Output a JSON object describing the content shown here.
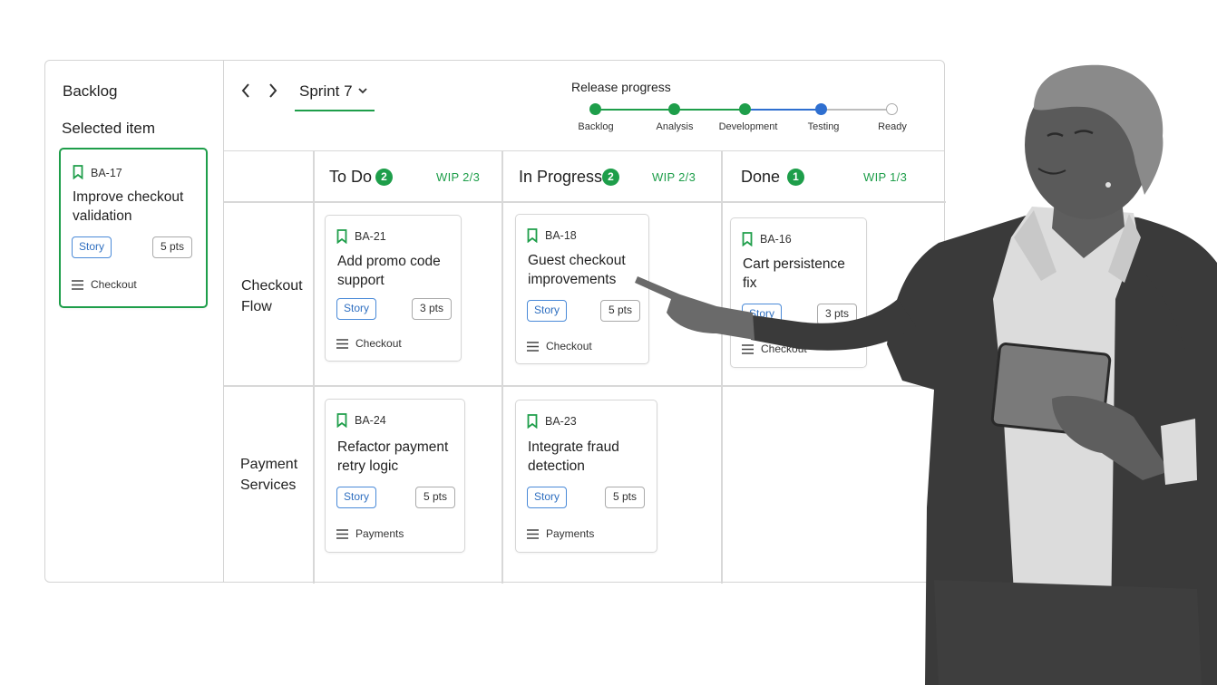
{
  "backlog": {
    "title": "Backlog",
    "selected_label": "Selected item",
    "selected_card": {
      "id": "BA-17",
      "title": "Improve checkout validation",
      "tag": "Story",
      "points": "5 pts",
      "component": "Checkout"
    }
  },
  "header": {
    "sprint": "Sprint 7",
    "release_title": "Release progress",
    "steps": [
      {
        "label": "Backlog",
        "state": "done"
      },
      {
        "label": "Analysis",
        "state": "done"
      },
      {
        "label": "Development",
        "state": "done"
      },
      {
        "label": "Testing",
        "state": "current"
      },
      {
        "label": "Ready",
        "state": "pending"
      }
    ]
  },
  "columns": [
    {
      "title": "To Do",
      "count": "2",
      "wip": "WIP  2/3"
    },
    {
      "title": "In Progress",
      "count": "2",
      "wip": "WIP  2/3"
    },
    {
      "title": "Done",
      "count": "1",
      "wip": "WIP  1/3"
    }
  ],
  "rows": [
    {
      "label": "Checkout Flow"
    },
    {
      "label": "Payment Services"
    }
  ],
  "cards": [
    {
      "id": "BA-21",
      "title": "Add promo code support",
      "tag": "Story",
      "points": "3 pts",
      "component": "Checkout"
    },
    {
      "id": "BA-18",
      "title": "Guest checkout improvements",
      "tag": "Story",
      "points": "5 pts",
      "component": "Checkout"
    },
    {
      "id": "BA-16",
      "title": "Cart persistence fix",
      "tag": "Story",
      "points": "3 pts",
      "component": "Checkout"
    },
    {
      "id": "BA-24",
      "title": "Refactor payment retry logic",
      "tag": "Story",
      "points": "5 pts",
      "component": "Payments"
    },
    {
      "id": "BA-23",
      "title": "Integrate fraud detection",
      "tag": "Story",
      "points": "5 pts",
      "component": "Payments"
    }
  ],
  "colors": {
    "accent": "#1e9e4a",
    "tag": "#4a8ad8",
    "current_step": "#2f6fd0",
    "pending_step": "#bdbdbd"
  }
}
